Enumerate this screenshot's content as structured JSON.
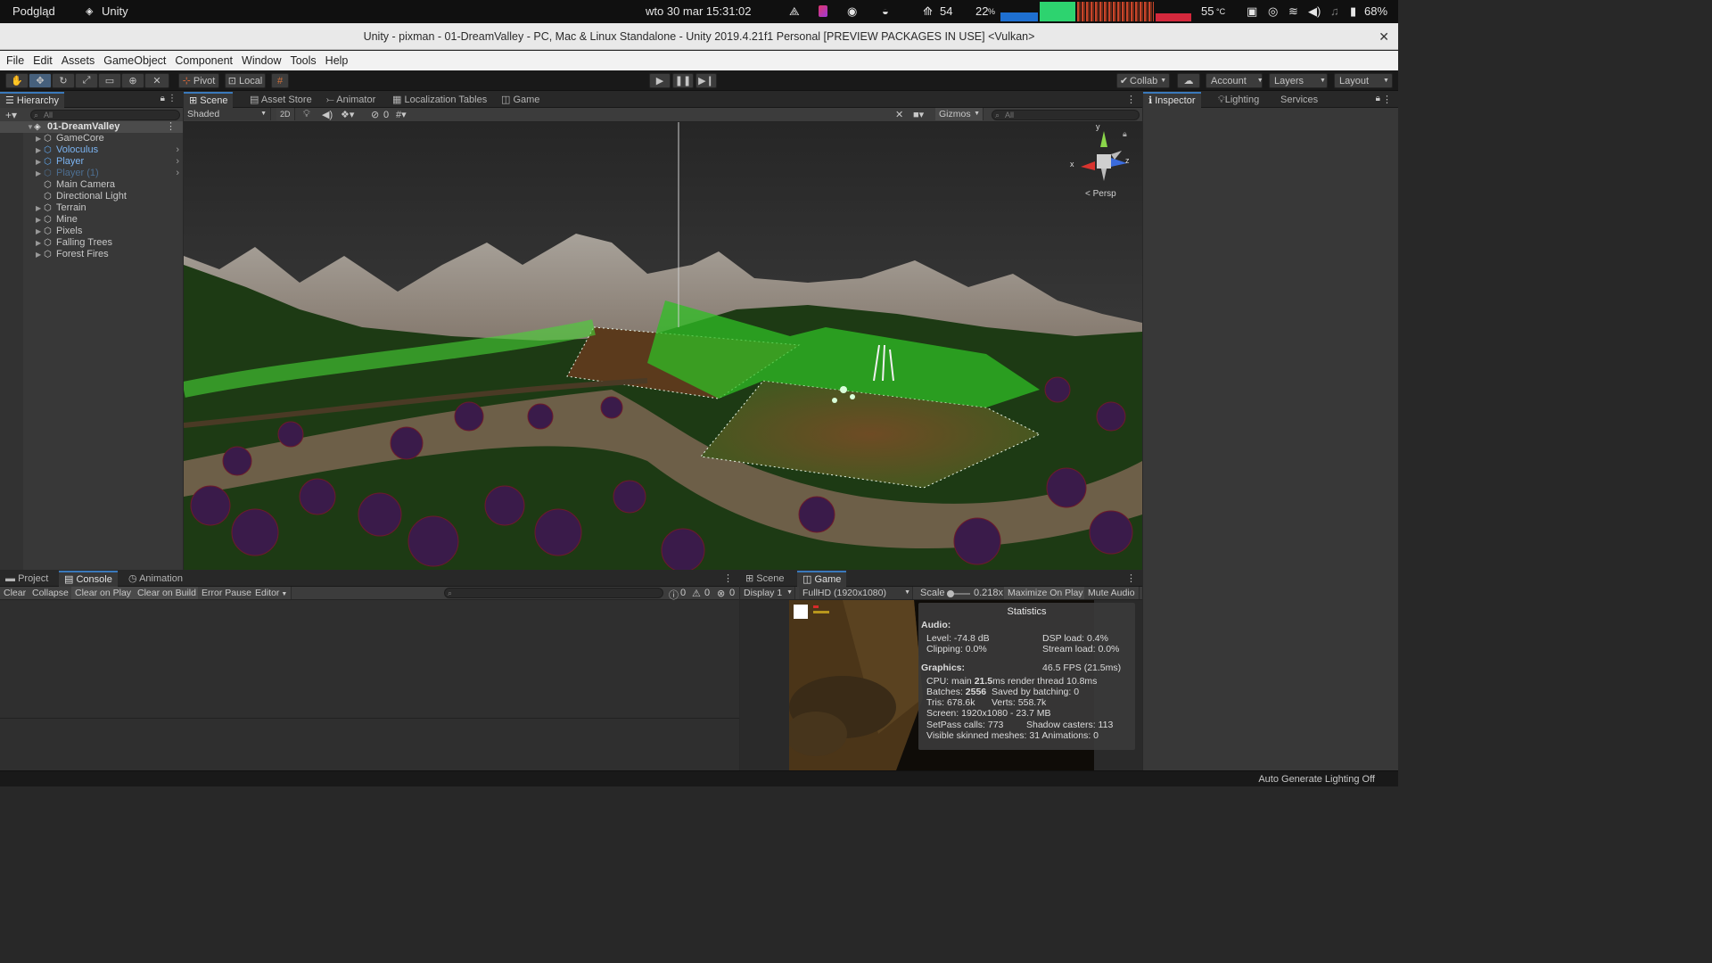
{
  "system_bar": {
    "preview": "Podgląd",
    "app": "Unity",
    "datetime": "wto 30 mar  15:31:02",
    "counter": "54",
    "cpu_percent": "22",
    "cpu_unit": "%",
    "temperature": "55",
    "temp_unit": "°C",
    "battery": "68%"
  },
  "window": {
    "title": "Unity - pixman - 01-DreamValley - PC, Mac & Linux Standalone - Unity 2019.4.21f1 Personal [PREVIEW PACKAGES IN USE] <Vulkan>",
    "close": "✕"
  },
  "menu": [
    "File",
    "Edit",
    "Assets",
    "GameObject",
    "Component",
    "Window",
    "Tools",
    "Help"
  ],
  "toolbar": {
    "pivot": "Pivot",
    "local": "Local",
    "collab": "Collab",
    "account": "Account",
    "layers": "Layers",
    "layout": "Layout"
  },
  "hierarchy": {
    "tab": "Hierarchy",
    "search_placeholder": "All",
    "scene": "01-DreamValley",
    "items": [
      {
        "label": "GameCore",
        "style": "normal"
      },
      {
        "label": "Voloculus",
        "style": "prefab"
      },
      {
        "label": "Player",
        "style": "prefab"
      },
      {
        "label": "Player (1)",
        "style": "disabled"
      },
      {
        "label": "Main Camera",
        "style": "normal"
      },
      {
        "label": "Directional Light",
        "style": "normal"
      },
      {
        "label": "Terrain",
        "style": "normal"
      },
      {
        "label": "Mine",
        "style": "normal"
      },
      {
        "label": "Pixels",
        "style": "normal"
      },
      {
        "label": "Falling Trees",
        "style": "normal"
      },
      {
        "label": "Forest Fires",
        "style": "normal"
      }
    ]
  },
  "scene_view": {
    "tabs": [
      "Scene",
      "Asset Store",
      "Animator",
      "Localization Tables",
      "Game"
    ],
    "shading": "Shaded",
    "mode_2d": "2D",
    "hidden_count": "0",
    "gizmos": "Gizmos",
    "search_placeholder": "All",
    "persp": "< Persp",
    "axis_y": "y",
    "axis_x": "x",
    "axis_z": "z"
  },
  "inspector": {
    "tabs": [
      "Inspector",
      "Lighting",
      "Services"
    ]
  },
  "console": {
    "tabs": [
      "Project",
      "Console",
      "Animation"
    ],
    "buttons": [
      "Clear",
      "Collapse",
      "Clear on Play",
      "Clear on Build",
      "Error Pause",
      "Editor"
    ],
    "counts": {
      "info": "0",
      "warn": "0",
      "error": "0"
    }
  },
  "game_view": {
    "tabs": [
      "Scene",
      "Game"
    ],
    "display": "Display 1",
    "resolution": "FullHD (1920x1080)",
    "scale_label": "Scale",
    "scale_value": "0.218x",
    "maximize": "Maximize On Play",
    "mute": "Mute Audio",
    "stats": {
      "title": "Statistics",
      "audio": "Audio:",
      "level": "Level: -74.8 dB",
      "dsp": "DSP load: 0.4%",
      "clipping": "Clipping: 0.0%",
      "stream": "Stream load: 0.0%",
      "graphics": "Graphics:",
      "fps": "46.5 FPS (21.5ms)",
      "cpu_prefix": "CPU: main ",
      "cpu_main": "21.5",
      "cpu_suffix": "ms  render thread 10.8ms",
      "batches_prefix": "Batches: ",
      "batches": "2556",
      "saved": "Saved by batching: 0",
      "tris": "Tris: 678.6k",
      "verts": "Verts: 558.7k",
      "screen": "Screen: 1920x1080 - 23.7 MB",
      "setpass": "SetPass calls: 773",
      "shadow": "Shadow casters: 113",
      "skinned": "Visible skinned meshes: 31  Animations: 0"
    }
  },
  "status_bar": {
    "right": "Auto Generate Lighting Off"
  }
}
